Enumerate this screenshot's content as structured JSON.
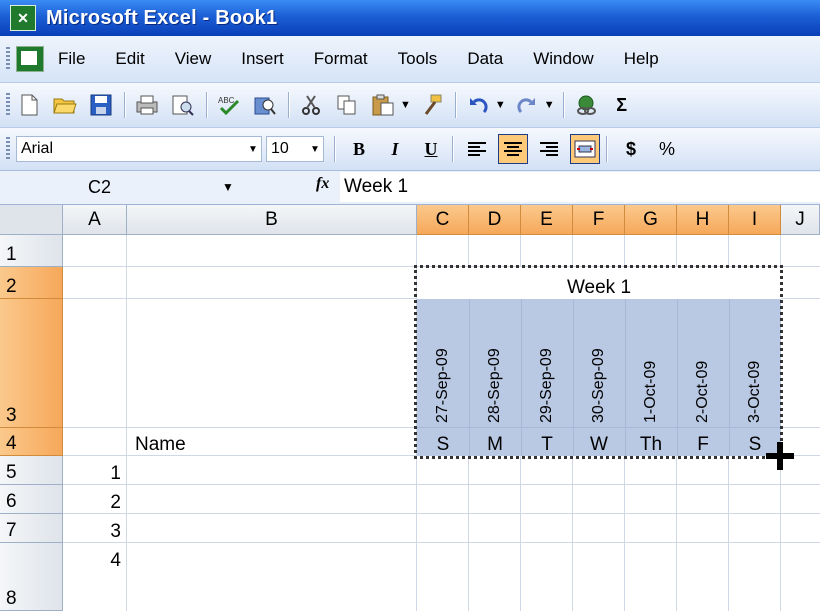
{
  "window": {
    "title": "Microsoft Excel - Book1"
  },
  "menu": [
    "File",
    "Edit",
    "View",
    "Insert",
    "Format",
    "Tools",
    "Data",
    "Window",
    "Help"
  ],
  "toolbar": {
    "icons": [
      "new-icon",
      "open-icon",
      "save-icon",
      "print-icon",
      "print-preview-icon",
      "spelling-icon",
      "research-icon",
      "cut-icon",
      "copy-icon",
      "paste-icon",
      "format-painter-icon",
      "undo-icon",
      "redo-icon",
      "hyperlink-icon",
      "sum-icon"
    ]
  },
  "format_bar": {
    "font_name": "Arial",
    "font_size": "10",
    "bold": "B",
    "italic": "I",
    "underline": "U",
    "currency": "$",
    "percent": "%"
  },
  "formula_bar": {
    "name_box": "C2",
    "fx": "fx",
    "value": "Week 1"
  },
  "columns": [
    "A",
    "B",
    "C",
    "D",
    "E",
    "F",
    "G",
    "H",
    "I",
    "J"
  ],
  "rows": [
    "1",
    "2",
    "3",
    "4",
    "5",
    "6",
    "7",
    "8"
  ],
  "cells": {
    "merged_week": "Week 1",
    "name_header": "Name",
    "dates": [
      "27-Sep-09",
      "28-Sep-09",
      "29-Sep-09",
      "30-Sep-09",
      "1-Oct-09",
      "2-Oct-09",
      "3-Oct-09"
    ],
    "days": [
      "S",
      "M",
      "T",
      "W",
      "Th",
      "F",
      "S"
    ],
    "row_numbers": [
      "1",
      "2",
      "3",
      "4"
    ]
  },
  "colors": {
    "title_bar": "#1c5fd6",
    "selection_fill": "#b9c9e3",
    "selected_header": "#f6a85a"
  }
}
